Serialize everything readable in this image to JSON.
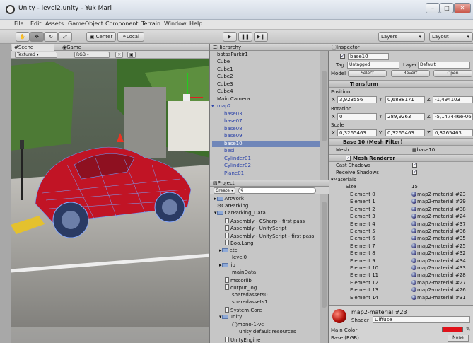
{
  "window": {
    "title": "Unity - level2.unity - Yuk Mari"
  },
  "menu": [
    "File",
    "Edit",
    "Assets",
    "GameObject",
    "Component",
    "Terrain",
    "Window",
    "Help"
  ],
  "toolbar": {
    "center": "Center",
    "local": "Local",
    "layers": "Layers",
    "layout": "Layout"
  },
  "scene": {
    "tab_scene": "Scene",
    "tab_game": "Game",
    "render": "Textured",
    "color": "RGB"
  },
  "hierarchy": {
    "title": "Hierarchy",
    "items": [
      "batasParkir1",
      "Cube",
      "Cube1",
      "Cube2",
      "Cube3",
      "Cube4",
      "Main Camera",
      "map2"
    ],
    "subitems": [
      "base03",
      "base07",
      "base08",
      "base09",
      "base10",
      "besi",
      "Cylinder01",
      "Cylinder02",
      "Plane01"
    ]
  },
  "project": {
    "title": "Project",
    "create": "Create",
    "items": [
      "Artwork",
      "CarParking",
      "CarParking_Data",
      "Assembly - CSharp - first pass",
      "Assembly - UnityScript",
      "Assembly - UnityScript - first pass",
      "Boo.Lang",
      "etc",
      "level0",
      "lib",
      "mainData",
      "mscorlib",
      "output_log",
      "sharedassets0",
      "sharedassets1",
      "System.Core",
      "unity",
      "mono-1-vc",
      "unity default resources",
      "UnityEngine"
    ]
  },
  "inspector": {
    "title": "Inspector",
    "object": "base10",
    "tag_label": "Tag",
    "tag": "Untagged",
    "layer_label": "Layer",
    "layer": "Default",
    "model_label": "Model",
    "select": "Select",
    "revert": "Revert",
    "open": "Open",
    "transform": "Transform",
    "position": "Position",
    "rotation": "Rotation",
    "scale": "Scale",
    "pos": {
      "x": "3,923556",
      "y": "0,6888171",
      "z": "-1,494103"
    },
    "rot": {
      "x": "0",
      "y": "289,9263",
      "z": "-5,147446e-06"
    },
    "scl": {
      "x": "0,3265463",
      "y": "0,3265463",
      "z": "0,3265463"
    },
    "mesh_filter": "Base 10 (Mesh Filter)",
    "mesh_label": "Mesh",
    "mesh": "base10",
    "mesh_renderer": "Mesh Renderer",
    "cast": "Cast Shadows",
    "receive": "Receive Shadows",
    "materials": "Materials",
    "size_label": "Size",
    "size": "15",
    "elements": [
      {
        "name": "Element 0",
        "mat": "map2-material #23"
      },
      {
        "name": "Element 1",
        "mat": "map2-material #29"
      },
      {
        "name": "Element 2",
        "mat": "map2-material #38"
      },
      {
        "name": "Element 3",
        "mat": "map2-material #24"
      },
      {
        "name": "Element 4",
        "mat": "map2-material #37"
      },
      {
        "name": "Element 5",
        "mat": "map2-material #36"
      },
      {
        "name": "Element 6",
        "mat": "map2-material #35"
      },
      {
        "name": "Element 7",
        "mat": "map2-material #25"
      },
      {
        "name": "Element 8",
        "mat": "map2-material #32"
      },
      {
        "name": "Element 9",
        "mat": "map2-material #34"
      },
      {
        "name": "Element 10",
        "mat": "map2-material #33"
      },
      {
        "name": "Element 11",
        "mat": "map2-material #28"
      },
      {
        "name": "Element 12",
        "mat": "map2-material #27"
      },
      {
        "name": "Element 13",
        "mat": "map2-material #26"
      },
      {
        "name": "Element 14",
        "mat": "map2-material #31"
      }
    ],
    "material_name": "map2-material #23",
    "shader_label": "Shader",
    "shader": "Diffuse",
    "main_color": "Main Color",
    "base_rgb": "Base (RGB)",
    "none": "None"
  }
}
